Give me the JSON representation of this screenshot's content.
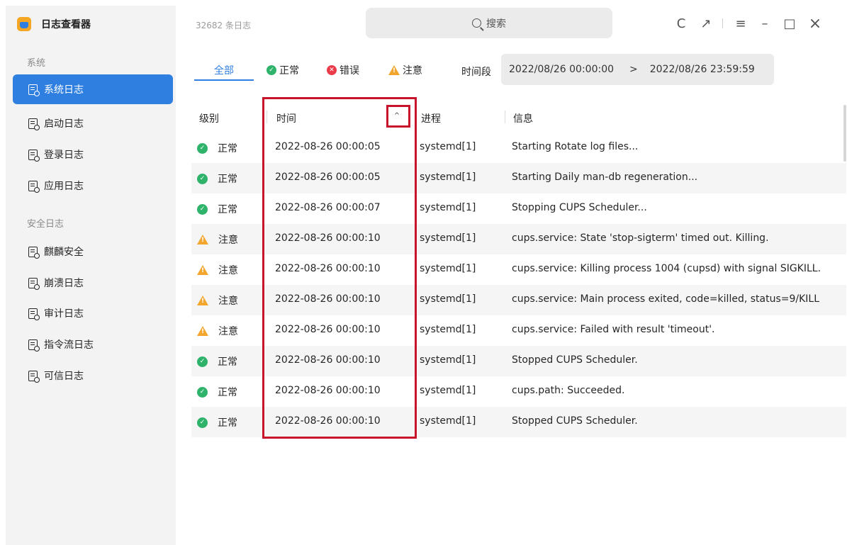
{
  "app": {
    "title": "日志查看器",
    "log_count": "32682 条日志"
  },
  "search": {
    "placeholder": "搜索"
  },
  "window_controls": {
    "refresh": "C",
    "export": "↗",
    "menu": "≡",
    "minimize": "–",
    "maximize": "□",
    "close": "×"
  },
  "sidebar": {
    "group_system": "系统",
    "system_items": [
      {
        "label": "系统日志",
        "active": true
      },
      {
        "label": "启动日志",
        "active": false
      },
      {
        "label": "登录日志",
        "active": false
      },
      {
        "label": "应用日志",
        "active": false
      }
    ],
    "group_security": "安全日志",
    "security_items": [
      {
        "label": "麒麟安全"
      },
      {
        "label": "崩溃日志"
      },
      {
        "label": "审计日志"
      },
      {
        "label": "指令流日志"
      },
      {
        "label": "可信日志"
      }
    ]
  },
  "filters": {
    "tabs": [
      {
        "label": "全部",
        "active": true
      },
      {
        "label": "正常",
        "icon": "check-icon"
      },
      {
        "label": "错误",
        "icon": "error-icon"
      },
      {
        "label": "注意",
        "icon": "warning-icon"
      }
    ],
    "period_label": "时间段",
    "period_start": "2022/08/26  00:00:00",
    "period_arrow": ">",
    "period_end": "2022/08/26  23:59:59"
  },
  "table": {
    "headers": {
      "level": "级别",
      "time": "时间",
      "process": "进程",
      "message": "信息"
    },
    "sort_icon": "^",
    "rows": [
      {
        "level": "正常",
        "type": "ok",
        "time": "2022-08-26 00:00:05",
        "process": "systemd[1]",
        "message": "Starting Rotate log files..."
      },
      {
        "level": "正常",
        "type": "ok",
        "time": "2022-08-26 00:00:05",
        "process": "systemd[1]",
        "message": "Starting Daily man-db regeneration..."
      },
      {
        "level": "正常",
        "type": "ok",
        "time": "2022-08-26 00:00:07",
        "process": "systemd[1]",
        "message": "Stopping CUPS Scheduler..."
      },
      {
        "level": "注意",
        "type": "warn",
        "time": "2022-08-26 00:00:10",
        "process": "systemd[1]",
        "message": "cups.service: State 'stop-sigterm' timed out. Killing."
      },
      {
        "level": "注意",
        "type": "warn",
        "time": "2022-08-26 00:00:10",
        "process": "systemd[1]",
        "message": "cups.service: Killing process 1004 (cupsd) with signal SIGKILL."
      },
      {
        "level": "注意",
        "type": "warn",
        "time": "2022-08-26 00:00:10",
        "process": "systemd[1]",
        "message": "cups.service: Main process exited, code=killed, status=9/KILL"
      },
      {
        "level": "注意",
        "type": "warn",
        "time": "2022-08-26 00:00:10",
        "process": "systemd[1]",
        "message": "cups.service: Failed with result 'timeout'."
      },
      {
        "level": "正常",
        "type": "ok",
        "time": "2022-08-26 00:00:10",
        "process": "systemd[1]",
        "message": "Stopped CUPS Scheduler."
      },
      {
        "level": "正常",
        "type": "ok",
        "time": "2022-08-26 00:00:10",
        "process": "systemd[1]",
        "message": "cups.path: Succeeded."
      },
      {
        "level": "正常",
        "type": "ok",
        "time": "2022-08-26 00:00:10",
        "process": "systemd[1]",
        "message": "Stopped CUPS Scheduler."
      }
    ]
  },
  "colors": {
    "accent": "#2f7fe0",
    "ok": "#2fb36b",
    "error": "#ea3b4b",
    "warning": "#f2a62e",
    "highlight": "#c8142b"
  }
}
